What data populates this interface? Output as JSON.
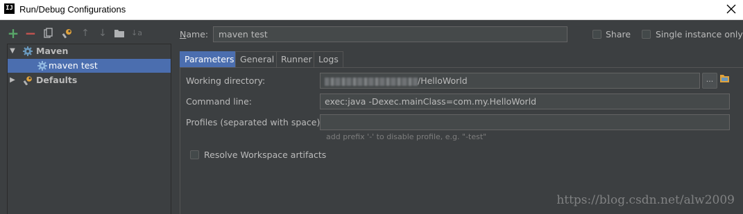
{
  "window": {
    "title": "Run/Debug Configurations",
    "app_icon_text": "IJ"
  },
  "toolbar": {
    "add": "+",
    "remove": "−",
    "copy": "⧉",
    "wrench": "🔧",
    "up": "↑",
    "down": "↓",
    "folder": "▬",
    "sort": "↓a"
  },
  "tree": {
    "groups": [
      {
        "label": "Maven",
        "expanded": true,
        "children": [
          "maven test"
        ]
      },
      {
        "label": "Defaults",
        "expanded": false
      }
    ]
  },
  "form": {
    "name_label_prefix": "N",
    "name_label_rest": "ame:",
    "name_value": "maven test",
    "share_label": "Share",
    "single_instance_label": "Single instance only"
  },
  "tabs": [
    "Parameters",
    "General",
    "Runner",
    "Logs"
  ],
  "parameters": {
    "working_directory_label": "Working directory:",
    "working_directory_value": "/HelloWorld",
    "working_directory_button": "...",
    "command_line_label": "Command line:",
    "command_line_value": "exec:java -Dexec.mainClass=com.my.HelloWorld",
    "profiles_label": "Profiles (separated with space):",
    "profiles_value": "",
    "profiles_hint": "add prefix '-' to disable profile, e.g. \"-test\"",
    "resolve_workspace_label": "Resolve Workspace artifacts"
  },
  "watermark": "https://blog.csdn.net/alw2009",
  "colors": {
    "background": "#3c3f41",
    "selection": "#4b6eaf",
    "add_green": "#59a869",
    "remove_red": "#c75450"
  }
}
